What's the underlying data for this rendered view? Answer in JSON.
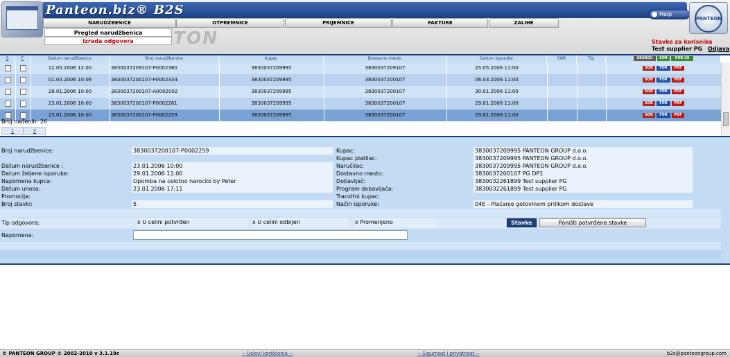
{
  "header": {
    "brand": "Panteon.biz® B2S",
    "help_label": "Help",
    "watermark": "TON",
    "right_logo_text": "PANTEON",
    "user_title": "Stavke za korisnika",
    "user_name": "Test supplier PG",
    "logout_label": "Odjava"
  },
  "nav": {
    "tabs": [
      "NARUDŽBENICE",
      "OTPREMNICE",
      "PRIJEMNICE",
      "FAKTURE",
      "ZALIHE"
    ],
    "sub_items": [
      "Pregled narudžbenica",
      "Izrada odgovora"
    ]
  },
  "grid": {
    "columns": [
      "S",
      "F",
      "Datum narudžbenice",
      "Broj narudžbenice",
      "Kupac",
      "Dostavno mesto",
      "Datum isporuke",
      "SOR",
      "Tip"
    ],
    "toolbar_actions": [
      "SEARCH",
      "SOR",
      "FOR-29"
    ],
    "row_actions": [
      "SOR",
      "FOR",
      "PDF"
    ],
    "rows": [
      {
        "date": "12.05.2006 12:00",
        "number": "3830037209107-P0002380",
        "buyer": "3830037209995",
        "location": "3830037209107",
        "delivery": "25.05.2006 11:00"
      },
      {
        "date": "01.03.2006 10:06",
        "number": "3830037200107-P0002334",
        "buyer": "3830037209995",
        "location": "3830037200107",
        "delivery": "06.03.2006 11:00"
      },
      {
        "date": "28.01.2006 10:00",
        "number": "3830037200107-A0002002",
        "buyer": "3830037209995",
        "location": "3830037200107",
        "delivery": "30.01.2006 11:00"
      },
      {
        "date": "23.01.2006 10:00",
        "number": "3830037200107-P0002261",
        "buyer": "3830037209995",
        "location": "3830037200107",
        "delivery": "29.01.2006 11:00"
      },
      {
        "date": "23.01.2006 10:00",
        "number": "3830037200107-P0002259",
        "buyer": "3830037209995",
        "location": "3830037200107",
        "delivery": "29.01.2006 11:00"
      }
    ],
    "count_label": "Broj nađenih: 26",
    "pages": [
      "1",
      "2"
    ]
  },
  "detail": {
    "left": [
      {
        "label": "Broj narudžbenice:",
        "value": "3830037200107-P0002259"
      },
      {
        "label": "Datum narudžbenice :",
        "value": "23.01.2006 10:00"
      },
      {
        "label": "Datum željene isporuke:",
        "value": "29.01.2006 11:00"
      },
      {
        "label": "Napomena kupca:",
        "value": "Opomba na celotno narocilo by Peter"
      },
      {
        "label": "Datum unosa:",
        "value": "23.01.2006 17:11"
      },
      {
        "label": "Promocija:",
        "value": ""
      },
      {
        "label": "Broj stavki:",
        "value": "5"
      }
    ],
    "right": [
      {
        "label": "Kupac:",
        "value": "3830037209995 PANTEON GROUP d.o.o."
      },
      {
        "label": "Kupac platilac:",
        "value": "3830037209995 PANTEON GROUP d.o.o."
      },
      {
        "label": "Naručilac:",
        "value": "3830037209995 PANTEON GROUP d.o.o."
      },
      {
        "label": "Dostavno mesto:",
        "value": "3830037200107 PG DP1"
      },
      {
        "label": "Dobavljač:",
        "value": "3830032261899 Test supplier PG"
      },
      {
        "label": "Program dobavljača:",
        "value": "3830032261899 Test supplier PG"
      },
      {
        "label": "Tranzitni kupac:",
        "value": ""
      },
      {
        "label": "Način isporuke:",
        "value": "04E - Plaćanje gotovinom prilikom dostave"
      }
    ],
    "response_label": "Tip odgovora:",
    "response_options": [
      "x  U celini potvrđen",
      "x  U celini odbijen",
      "x  Promenjeno"
    ],
    "stavke_label": "Stavke",
    "reset_label": "Poništi potvrđene stavke",
    "note_label": "Napomena:",
    "note_value": ""
  },
  "footer": {
    "copyright": "© PANTEON GROUP © 2002-2010 v 3.1.19c",
    "terms": "-- Uslovi korišćenja --",
    "privacy": "-- Sigurnost i privatnost --",
    "email": "b2s@panteongroup.com"
  },
  "colors": {
    "brand_blue": "#1b3f7a",
    "row_selected": "#7ba2d4",
    "alert_red": "#c00000"
  }
}
